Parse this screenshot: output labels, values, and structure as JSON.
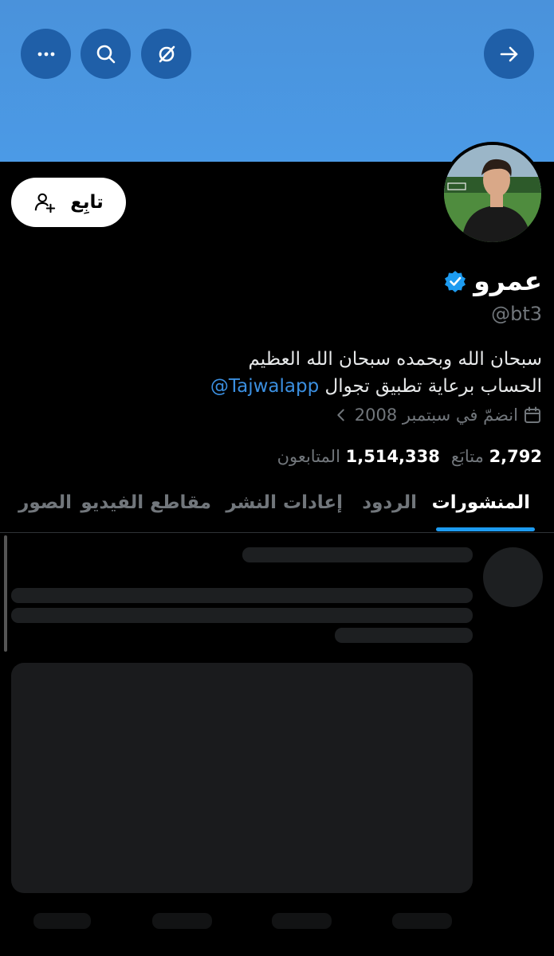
{
  "profile": {
    "name": "عمرو",
    "handle": "@bt3",
    "bio_line1": "سبحان الله وبحمده سبحان الله العظيم",
    "bio_line2_text": "الحساب برعاية تطبيق تجوال",
    "bio_mention": "@Tajwalapp",
    "joined": "انضمّ في سبتمبر 2008",
    "following_count": "2,792",
    "following_label": "متابَع",
    "followers_count": "1,514,338",
    "followers_label": "المتابعون",
    "verified": true
  },
  "actions": {
    "follow_label": "تابِع"
  },
  "tabs": [
    {
      "label": "المنشورات",
      "active": true
    },
    {
      "label": "الردود",
      "active": false
    },
    {
      "label": "إعادات النشر",
      "active": false
    },
    {
      "label": "مقاطع الفيديو",
      "active": false
    },
    {
      "label": "الصور",
      "active": false
    }
  ],
  "colors": {
    "banner": "#4b97e3",
    "accent": "#1d9bf0",
    "background": "#000000"
  }
}
